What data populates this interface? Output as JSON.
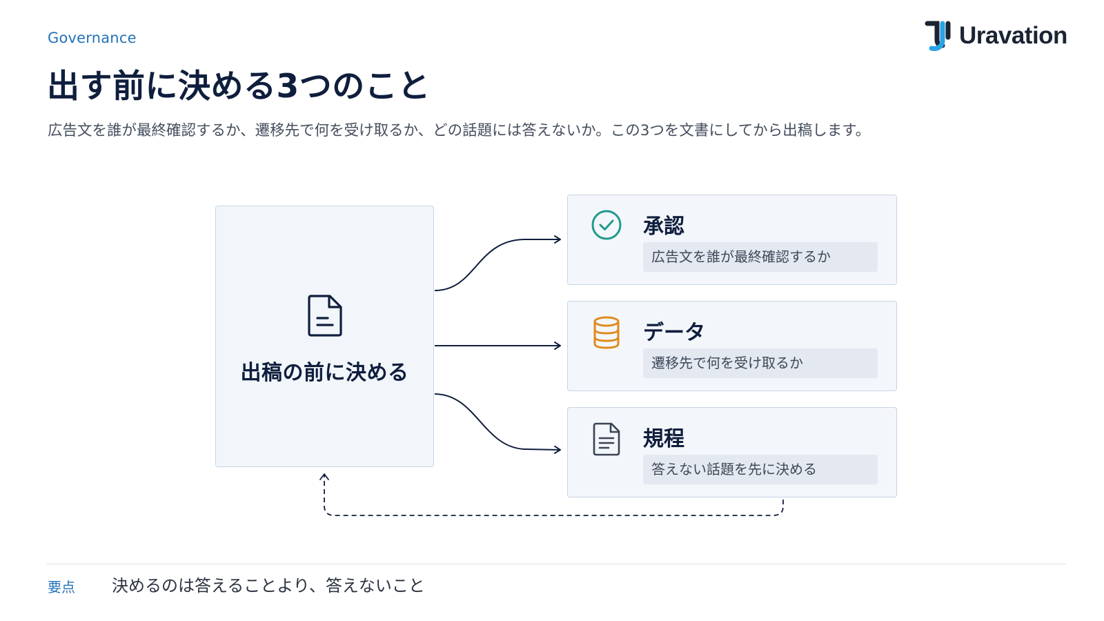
{
  "header": {
    "eyebrow": "Governance",
    "title": "出す前に決める3つのこと",
    "subtitle": "広告文を誰が最終確認するか、遷移先で何を受け取るか、どの話題には答えないか。この3つを文書にしてから出稿します。",
    "logo_text": "Uravation"
  },
  "diagram": {
    "source": {
      "icon": "document-icon",
      "label": "出稿の前に決める"
    },
    "cards": [
      {
        "icon": "check-circle-icon",
        "icon_color": "#1f9a8c",
        "title": "承認",
        "description": "広告文を誰が最終確認するか"
      },
      {
        "icon": "database-icon",
        "icon_color": "#e08a1c",
        "title": "データ",
        "description": "遷移先で何を受け取るか"
      },
      {
        "icon": "document-lines-icon",
        "icon_color": "#3a4352",
        "title": "規程",
        "description": "答えない話題を先に決める"
      }
    ]
  },
  "key_point": {
    "label": "要点",
    "text": "決めるのは答えることより、答えないこと"
  },
  "colors": {
    "navy": "#0f1e3d",
    "accent_blue": "#2472b8",
    "card_bg": "#f3f6fa",
    "card_border": "#c9d5e3"
  }
}
